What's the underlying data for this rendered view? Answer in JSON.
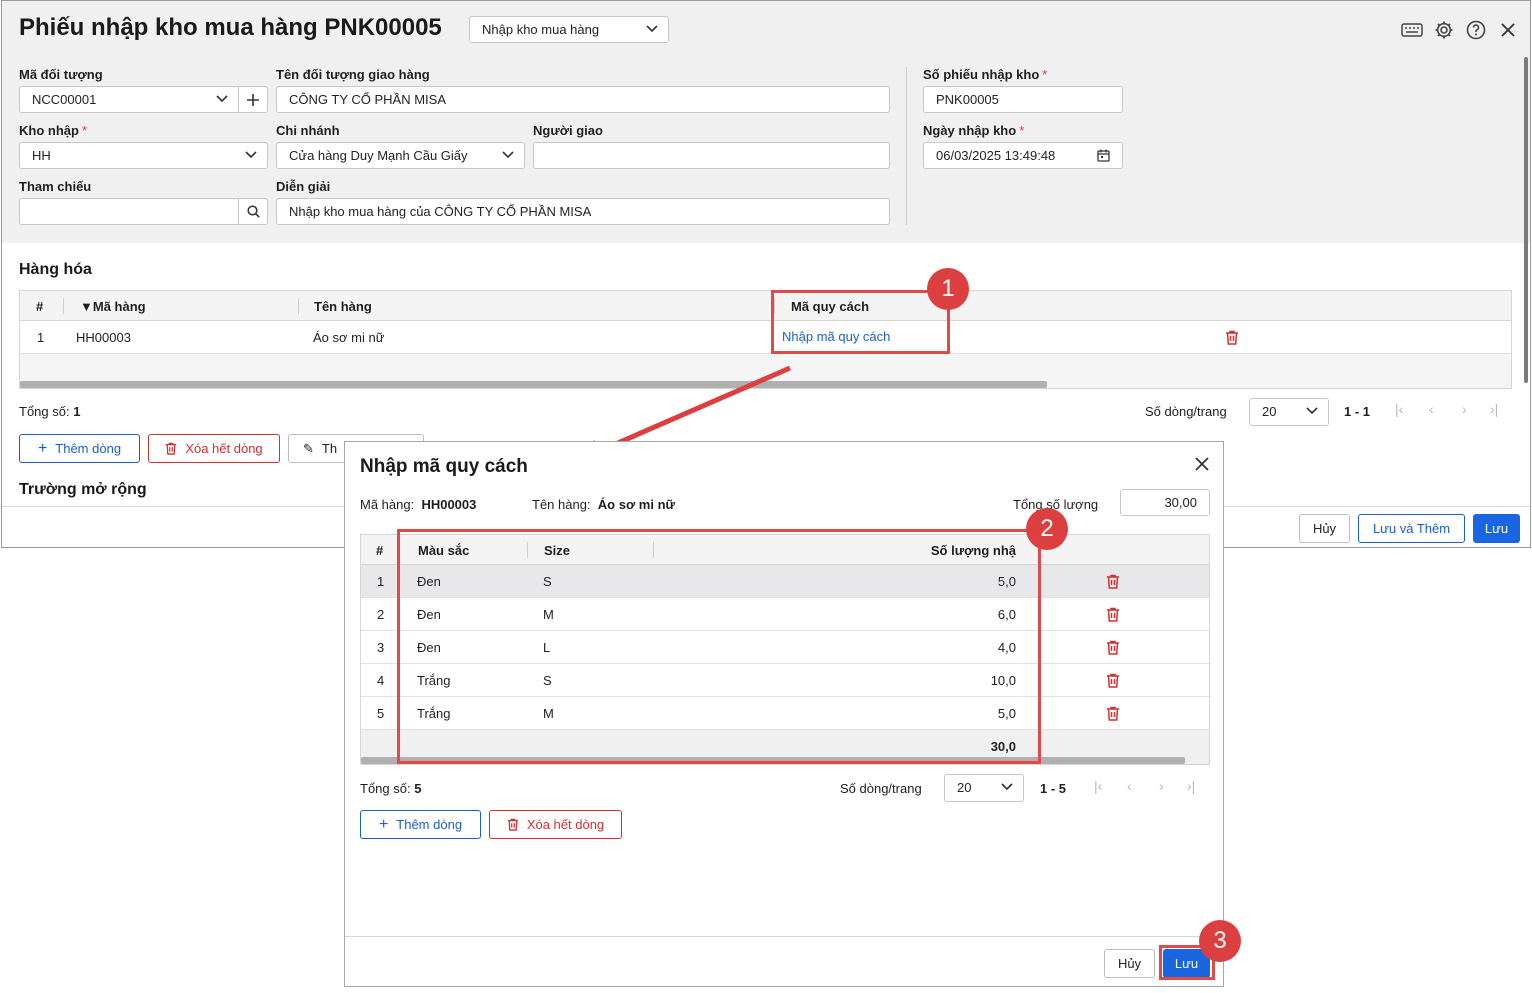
{
  "header": {
    "title": "Phiếu nhập kho mua hàng PNK00005",
    "type_select": "Nhập kho mua hàng"
  },
  "form": {
    "ma_doi_tuong_label": "Mã đối tượng",
    "ma_doi_tuong_value": "NCC00001",
    "ten_doi_tuong_label": "Tên đối tượng giao hàng",
    "ten_doi_tuong_value": "CÔNG TY CỔ PHẦN MISA",
    "so_phieu_label": "Số phiếu nhập kho",
    "so_phieu_value": "PNK00005",
    "kho_nhap_label": "Kho nhập",
    "kho_nhap_value": "HH",
    "chi_nhanh_label": "Chi nhánh",
    "chi_nhanh_value": "Cửa hàng Duy Mạnh Cầu Giấy",
    "nguoi_giao_label": "Người giao",
    "nguoi_giao_value": "",
    "ngay_nhap_label": "Ngày nhập kho",
    "ngay_nhap_value": "06/03/2025 13:49:48",
    "tham_chieu_label": "Tham chiếu",
    "tham_chieu_value": "",
    "dien_giai_label": "Diễn giải",
    "dien_giai_value": "Nhập kho mua hàng của CÔNG TY CỔ PHẦN MISA",
    "required_mark": "*"
  },
  "goods": {
    "section_title": "Hàng hóa",
    "columns": [
      "#",
      "Mã hàng",
      "Tên hàng",
      "Mã quy cách"
    ],
    "rows": [
      {
        "no": "1",
        "code": "HH00003",
        "name": "Áo sơ mi nữ",
        "spec": "Nhập mã quy cách"
      }
    ],
    "total_label": "Tổng số:",
    "total_value": "1",
    "page_size_label": "Số dòng/trang",
    "page_size": "20",
    "range": "1 - 1",
    "add_row": "Thêm dòng",
    "delete_all": "Xóa hết dòng",
    "third_btn": "Th"
  },
  "extension_title": "Trường mở rộng",
  "footer": {
    "cancel": "Hủy",
    "save_add": "Lưu và Thêm",
    "save": "Lưu"
  },
  "dialog": {
    "title": "Nhập mã quy cách",
    "ma_hang_label": "Mã hàng:",
    "ma_hang_value": "HH00003",
    "ten_hang_label": "Tên hàng:",
    "ten_hang_value": "Áo sơ mi nữ",
    "tong_sl_label": "Tổng số lượng",
    "tong_sl_value": "30,00",
    "columns": [
      "#",
      "Màu sắc",
      "Size",
      "Số lượng nhậ"
    ],
    "rows": [
      {
        "no": "1",
        "color": "Đen",
        "size": "S",
        "qty": "5,0"
      },
      {
        "no": "2",
        "color": "Đen",
        "size": "M",
        "qty": "6,0"
      },
      {
        "no": "3",
        "color": "Đen",
        "size": "L",
        "qty": "4,0"
      },
      {
        "no": "4",
        "color": "Trắng",
        "size": "S",
        "qty": "10,0"
      },
      {
        "no": "5",
        "color": "Trắng",
        "size": "M",
        "qty": "5,0"
      }
    ],
    "sum_qty": "30,0",
    "total_label": "Tổng số:",
    "total_value": "5",
    "page_size_label": "Số dòng/trang",
    "page_size": "20",
    "range": "1 - 5",
    "add_row": "Thêm dòng",
    "delete_all": "Xóa hết dòng",
    "cancel": "Hủy",
    "save": "Lưu"
  },
  "annotations": [
    "1",
    "2",
    "3"
  ],
  "colors": {
    "accent": "#1a66e0",
    "danger": "#d32f2f",
    "highlight": "#e04a4a",
    "form_bg": "#f0f0f1"
  }
}
